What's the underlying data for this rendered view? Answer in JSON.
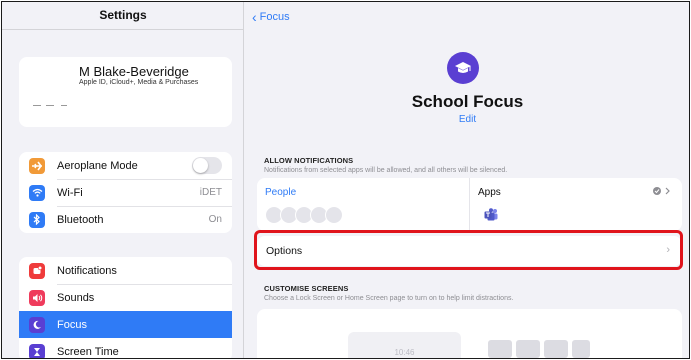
{
  "sidebar": {
    "title": "Settings",
    "profile": {
      "name": "M Blake-Beveridge",
      "subtitle": "Apple ID, iCloud+, Media & Purchases"
    },
    "connectivity": [
      {
        "label": "Aeroplane Mode",
        "icon": "airplane-icon",
        "color": "#f19a38",
        "toggle": false
      },
      {
        "label": "Wi-Fi",
        "icon": "wifi-icon",
        "color": "#2f7bf6",
        "value": "iDET"
      },
      {
        "label": "Bluetooth",
        "icon": "bluetooth-icon",
        "color": "#2f7bf6",
        "value": "On"
      }
    ],
    "system": [
      {
        "label": "Notifications",
        "icon": "bell-icon",
        "color": "#ef3b3b"
      },
      {
        "label": "Sounds",
        "icon": "speaker-icon",
        "color": "#ef3b5c"
      },
      {
        "label": "Focus",
        "icon": "moon-icon",
        "color": "#5a3fd2",
        "selected": true
      },
      {
        "label": "Screen Time",
        "icon": "hourglass-icon",
        "color": "#5a3fd2"
      }
    ]
  },
  "main": {
    "back_label": "Focus",
    "focus_name": "School Focus",
    "edit_label": "Edit",
    "allow": {
      "heading": "ALLOW NOTIFICATIONS",
      "description": "Notifications from selected apps will be allowed, and all others will be silenced.",
      "people_label": "People",
      "apps_label": "Apps"
    },
    "options_label": "Options",
    "customise": {
      "heading": "CUSTOMISE SCREENS",
      "description": "Choose a Lock Screen or Home Screen page to turn on to help limit distractions.",
      "lock_preview_time": "10:46"
    }
  },
  "colors": {
    "accent": "#2f7bf6",
    "focus_purple": "#5a3fd2",
    "highlight_red": "#e0141c"
  }
}
